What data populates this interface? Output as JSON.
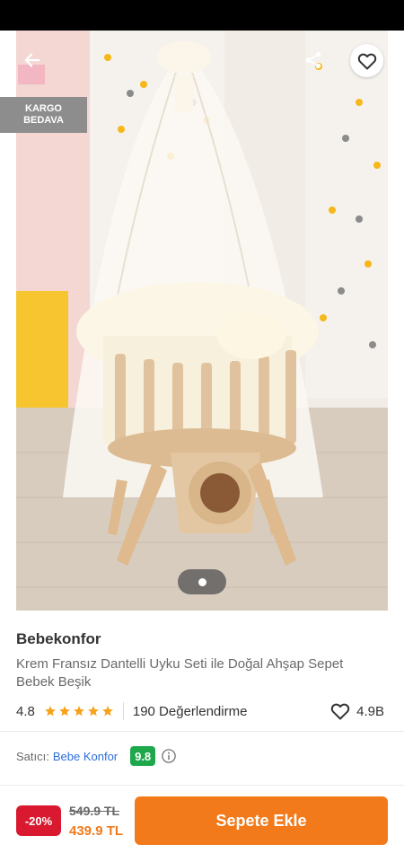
{
  "product": {
    "brand": "Bebekonfor",
    "title": "Krem Fransız Dantelli Uyku Seti ile Doğal Ahşap Sepet Bebek Beşik",
    "rating": "4.8",
    "rating_stars": 5,
    "review_count": "190 Değerlendirme",
    "favorite_count": "4.9B"
  },
  "gallery": {
    "badge_line1": "KARGO",
    "badge_line2": "BEDAVA",
    "current_page": 1,
    "page_count": 1
  },
  "seller": {
    "label": "Satıcı:",
    "name": "Bebe Konfor",
    "score": "9.8"
  },
  "purchase": {
    "discount": "-20%",
    "old_price": "549.9 TL",
    "new_price": "439.9 TL",
    "add_button": "Sepete Ekle"
  },
  "icons": {
    "back": "arrow-left-icon",
    "share": "share-icon",
    "favorite": "heart-icon",
    "star": "star-icon",
    "info": "info-icon"
  },
  "colors": {
    "accent": "#f27a1a",
    "star": "#f7a21b",
    "discount": "#d9192f",
    "seller_score": "#1ea84b",
    "seller_link": "#2e6fd9"
  }
}
